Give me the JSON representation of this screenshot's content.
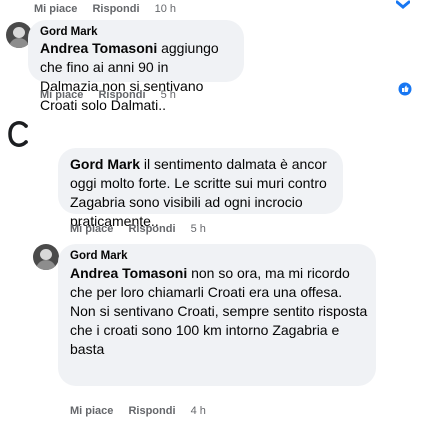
{
  "top_actions": {
    "like": "Mi piace",
    "reply": "Rispondi",
    "time": "10 h"
  },
  "comment1": {
    "author": "Gord Mark",
    "mention": "Andrea Tomasoni",
    "text": " aggiungo che fino ai anni 90 in Dalmazia non si sentivano Croati solo Dalmati..",
    "like": "Mi piace",
    "reply": "Rispondi",
    "time": "5 h"
  },
  "comment2": {
    "mention": "Gord Mark",
    "text": " il sentimento dalmata è ancor oggi molto forte. Le scritte sui muri contro Zagabria sono visibili ad ogni incrocio praticamente..",
    "like": "Mi piace",
    "reply": "Rispondi",
    "time": "5 h"
  },
  "comment3": {
    "author": "Gord Mark",
    "mention": "Andrea Tomasoni",
    "text": " non so ora, ma mi ricordo che per loro chiamarli Croati era una offesa. Non si sentivano Croati, sempre sentito risposta che i croati sono 100 km intorno Zagabria e basta",
    "like": "Mi piace",
    "reply": "Rispondi",
    "time": "4 h"
  },
  "icons": {
    "top_right": "chevron-down-icon",
    "reaction": "like-reaction-icon",
    "avatar_c": "letter-c-avatar-icon"
  },
  "colors": {
    "bubble": "#f0f2f5",
    "meta": "#65676b",
    "reaction_blue": "#1877f2"
  }
}
